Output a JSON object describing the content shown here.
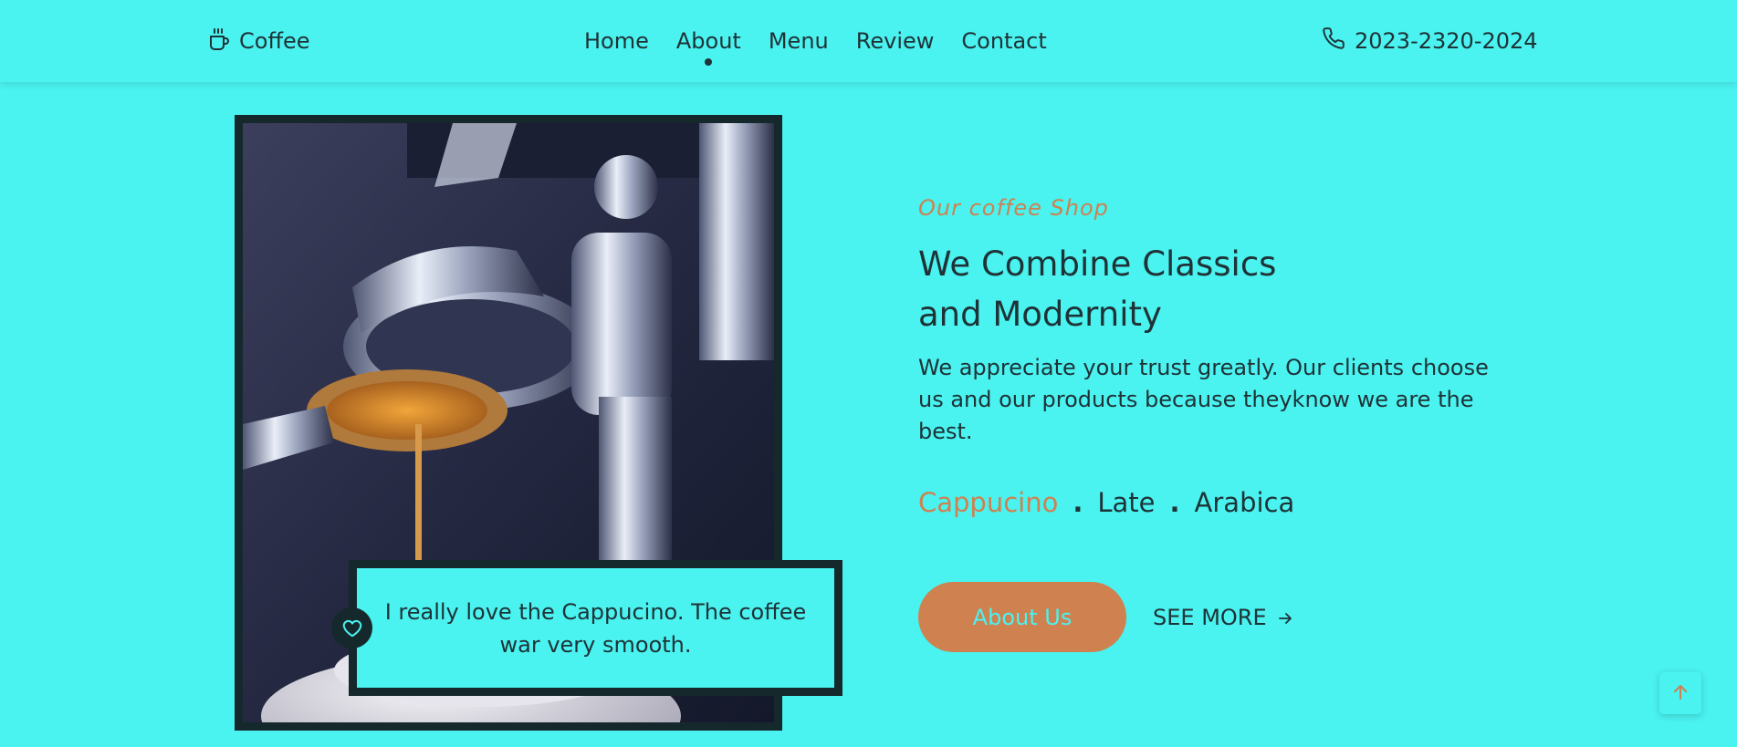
{
  "header": {
    "logo": {
      "icon": "coffee-cup-icon",
      "text": "Coffee"
    },
    "nav": [
      {
        "label": "Home",
        "active": false
      },
      {
        "label": "About",
        "active": true
      },
      {
        "label": "Menu",
        "active": false
      },
      {
        "label": "Review",
        "active": false
      },
      {
        "label": "Contact",
        "active": false
      }
    ],
    "phone": {
      "icon": "phone-icon",
      "number": "2023-2320-2024"
    }
  },
  "about": {
    "image": {
      "subject": "espresso machine pouring coffee"
    },
    "testimonial": {
      "icon": "heart-icon",
      "text": "I really love the Cappucino. The coffee war very smooth."
    },
    "eyebrow": "Our coffee Shop",
    "headline_line1": "We Combine Classics",
    "headline_line2": "and Modernity",
    "description": "We appreciate your trust greatly. Our clients choose us and our products because theyknow we are the best.",
    "tags": [
      {
        "label": "Cappucino",
        "active": true
      },
      {
        "label": "Late",
        "active": false
      },
      {
        "label": "Arabica",
        "active": false
      }
    ],
    "tag_separator": ".",
    "primary_button": "About Us",
    "secondary_link": "SEE MORE",
    "secondary_icon": "arrow-right-icon"
  },
  "scroll_top": {
    "icon": "arrow-up-icon"
  },
  "colors": {
    "background": "#4AF2F0",
    "accent": "#CF8150",
    "text": "#1F3236",
    "frame": "#15292D"
  }
}
